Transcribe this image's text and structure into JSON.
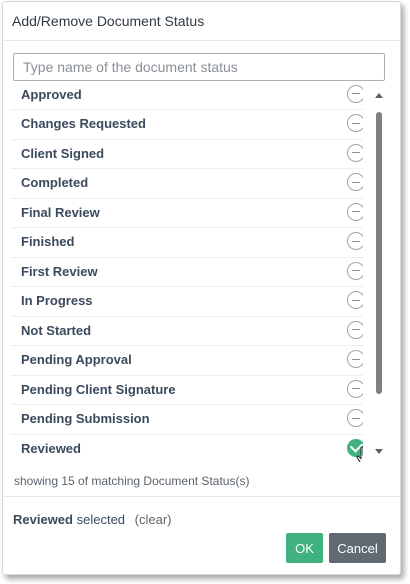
{
  "dialog": {
    "title": "Add/Remove Document Status"
  },
  "search": {
    "placeholder": "Type name of the document status",
    "value": ""
  },
  "statuses": [
    {
      "label": "Approved",
      "selected": false
    },
    {
      "label": "Changes Requested",
      "selected": false
    },
    {
      "label": "Client Signed",
      "selected": false
    },
    {
      "label": "Completed",
      "selected": false
    },
    {
      "label": "Final Review",
      "selected": false
    },
    {
      "label": "Finished",
      "selected": false
    },
    {
      "label": "First Review",
      "selected": false
    },
    {
      "label": "In Progress",
      "selected": false
    },
    {
      "label": "Not Started",
      "selected": false
    },
    {
      "label": "Pending Approval",
      "selected": false
    },
    {
      "label": "Pending Client Signature",
      "selected": false
    },
    {
      "label": "Pending Submission",
      "selected": false
    },
    {
      "label": "Reviewed",
      "selected": true
    }
  ],
  "icons": {
    "unselected": "minus-circle-icon",
    "selected": "check-circle-icon",
    "cursor": "hand-pointer-icon",
    "scroll_up": "triangle-up-icon",
    "scroll_down": "triangle-down-icon"
  },
  "count_text": "showing 15 of matching Document Status(s)",
  "selection": {
    "name": "Reviewed",
    "suffix": "selected",
    "clear_label": "(clear)"
  },
  "buttons": {
    "ok_label": "OK",
    "cancel_label": "Cancel"
  },
  "colors": {
    "accent": "#3fb27f",
    "cancel": "#616a73",
    "text": "#3a4a5c"
  }
}
